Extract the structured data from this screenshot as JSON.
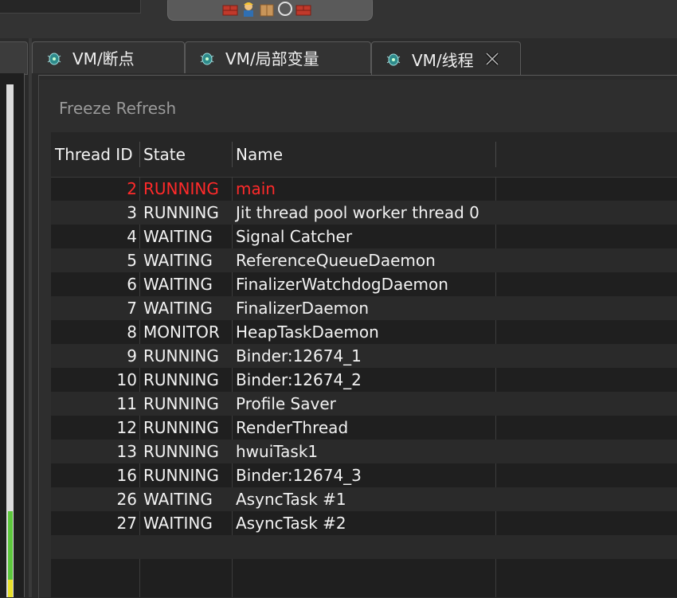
{
  "tabs": [
    {
      "label": "VM/断点",
      "active": false
    },
    {
      "label": "VM/局部变量",
      "active": false
    },
    {
      "label": "VM/线程",
      "active": true
    }
  ],
  "toolbar": {
    "icons": [
      "brick-icon",
      "worker-icon",
      "package-icon",
      "circle-icon",
      "brick-icon"
    ]
  },
  "panel": {
    "refresh_label": "Freeze Refresh"
  },
  "table": {
    "headers": {
      "thread_id": "Thread ID",
      "state": "State",
      "name": "Name"
    },
    "rows": [
      {
        "id": "2",
        "state": "RUNNING",
        "name": "main",
        "selected": true
      },
      {
        "id": "3",
        "state": "RUNNING",
        "name": "Jit thread pool worker thread 0"
      },
      {
        "id": "4",
        "state": "WAITING",
        "name": "Signal Catcher"
      },
      {
        "id": "5",
        "state": "WAITING",
        "name": "ReferenceQueueDaemon"
      },
      {
        "id": "6",
        "state": "WAITING",
        "name": "FinalizerWatchdogDaemon"
      },
      {
        "id": "7",
        "state": "WAITING",
        "name": "FinalizerDaemon"
      },
      {
        "id": "8",
        "state": "MONITOR",
        "name": "HeapTaskDaemon"
      },
      {
        "id": "9",
        "state": "RUNNING",
        "name": "Binder:12674_1"
      },
      {
        "id": "10",
        "state": "RUNNING",
        "name": "Binder:12674_2"
      },
      {
        "id": "11",
        "state": "RUNNING",
        "name": "Profile Saver"
      },
      {
        "id": "12",
        "state": "RUNNING",
        "name": "RenderThread"
      },
      {
        "id": "13",
        "state": "RUNNING",
        "name": "hwuiTask1"
      },
      {
        "id": "16",
        "state": "RUNNING",
        "name": "Binder:12674_3"
      },
      {
        "id": "26",
        "state": "WAITING",
        "name": "AsyncTask #1"
      },
      {
        "id": "27",
        "state": "WAITING",
        "name": "AsyncTask #2"
      }
    ]
  },
  "colors": {
    "selected_row": "#ff2a2a",
    "accent_scroll_green": "#5dc83c",
    "accent_scroll_yellow": "#e8e02a"
  }
}
